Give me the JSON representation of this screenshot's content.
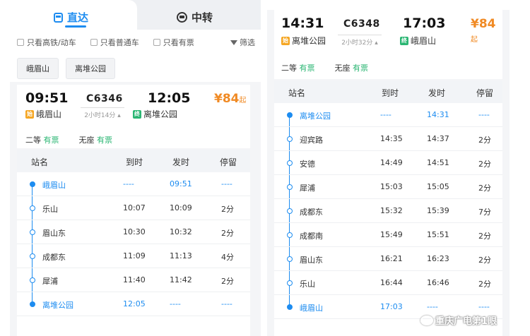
{
  "left": {
    "tabs": {
      "direct": "直达",
      "transfer": "中转"
    },
    "filters": [
      "只看高铁/动车",
      "只看普通车",
      "只看有票"
    ],
    "filter_button": "筛选",
    "chips": [
      "峨眉山",
      "离堆公园"
    ],
    "train": {
      "depart_time": "09:51",
      "train_no": "C6346",
      "arrive_time": "12:05",
      "duration": "2小时14分",
      "from": "峨眉山",
      "to": "离堆公园",
      "price": "¥84",
      "price_suffix": "起",
      "seat1_class": "二等",
      "seat1_status": "有票",
      "seat2_class": "无座",
      "seat2_status": "有票"
    },
    "table": {
      "headers": [
        "站名",
        "到时",
        "发时",
        "停留"
      ],
      "rows": [
        {
          "station": "峨眉山",
          "arrive": "----",
          "depart": "09:51",
          "stay": "----"
        },
        {
          "station": "乐山",
          "arrive": "10:07",
          "depart": "10:09",
          "stay": "2分"
        },
        {
          "station": "眉山东",
          "arrive": "10:30",
          "depart": "10:32",
          "stay": "2分"
        },
        {
          "station": "成都东",
          "arrive": "11:09",
          "depart": "11:13",
          "stay": "4分"
        },
        {
          "station": "犀浦",
          "arrive": "11:40",
          "depart": "11:42",
          "stay": "2分"
        },
        {
          "station": "离堆公园",
          "arrive": "12:05",
          "depart": "----",
          "stay": "----"
        }
      ]
    }
  },
  "right": {
    "train": {
      "depart_time": "14:31",
      "train_no": "C6348",
      "arrive_time": "17:03",
      "duration": "2小时32分",
      "from": "离堆公园",
      "to": "峨眉山",
      "price": "¥84",
      "price_suffix": "起",
      "seat1_class": "二等",
      "seat1_status": "有票",
      "seat2_class": "无座",
      "seat2_status": "有票"
    },
    "table": {
      "headers": [
        "站名",
        "到时",
        "发时",
        "停留"
      ],
      "rows": [
        {
          "station": "离堆公园",
          "arrive": "----",
          "depart": "14:31",
          "stay": "----"
        },
        {
          "station": "迎宾路",
          "arrive": "14:35",
          "depart": "14:37",
          "stay": "2分"
        },
        {
          "station": "安德",
          "arrive": "14:49",
          "depart": "14:51",
          "stay": "2分"
        },
        {
          "station": "犀浦",
          "arrive": "15:03",
          "depart": "15:05",
          "stay": "2分"
        },
        {
          "station": "成都东",
          "arrive": "15:32",
          "depart": "15:39",
          "stay": "7分"
        },
        {
          "station": "成都南",
          "arrive": "15:49",
          "depart": "15:51",
          "stay": "2分"
        },
        {
          "station": "眉山东",
          "arrive": "16:21",
          "depart": "16:23",
          "stay": "2分"
        },
        {
          "station": "乐山",
          "arrive": "16:44",
          "depart": "16:46",
          "stay": "2分"
        },
        {
          "station": "峨眉山",
          "arrive": "17:03",
          "depart": "----",
          "stay": "----"
        }
      ]
    }
  },
  "watermark": "重庆广电第1眼",
  "colors": {
    "accent": "#1d8cf0",
    "price": "#f08a24",
    "available": "#2bb673"
  }
}
